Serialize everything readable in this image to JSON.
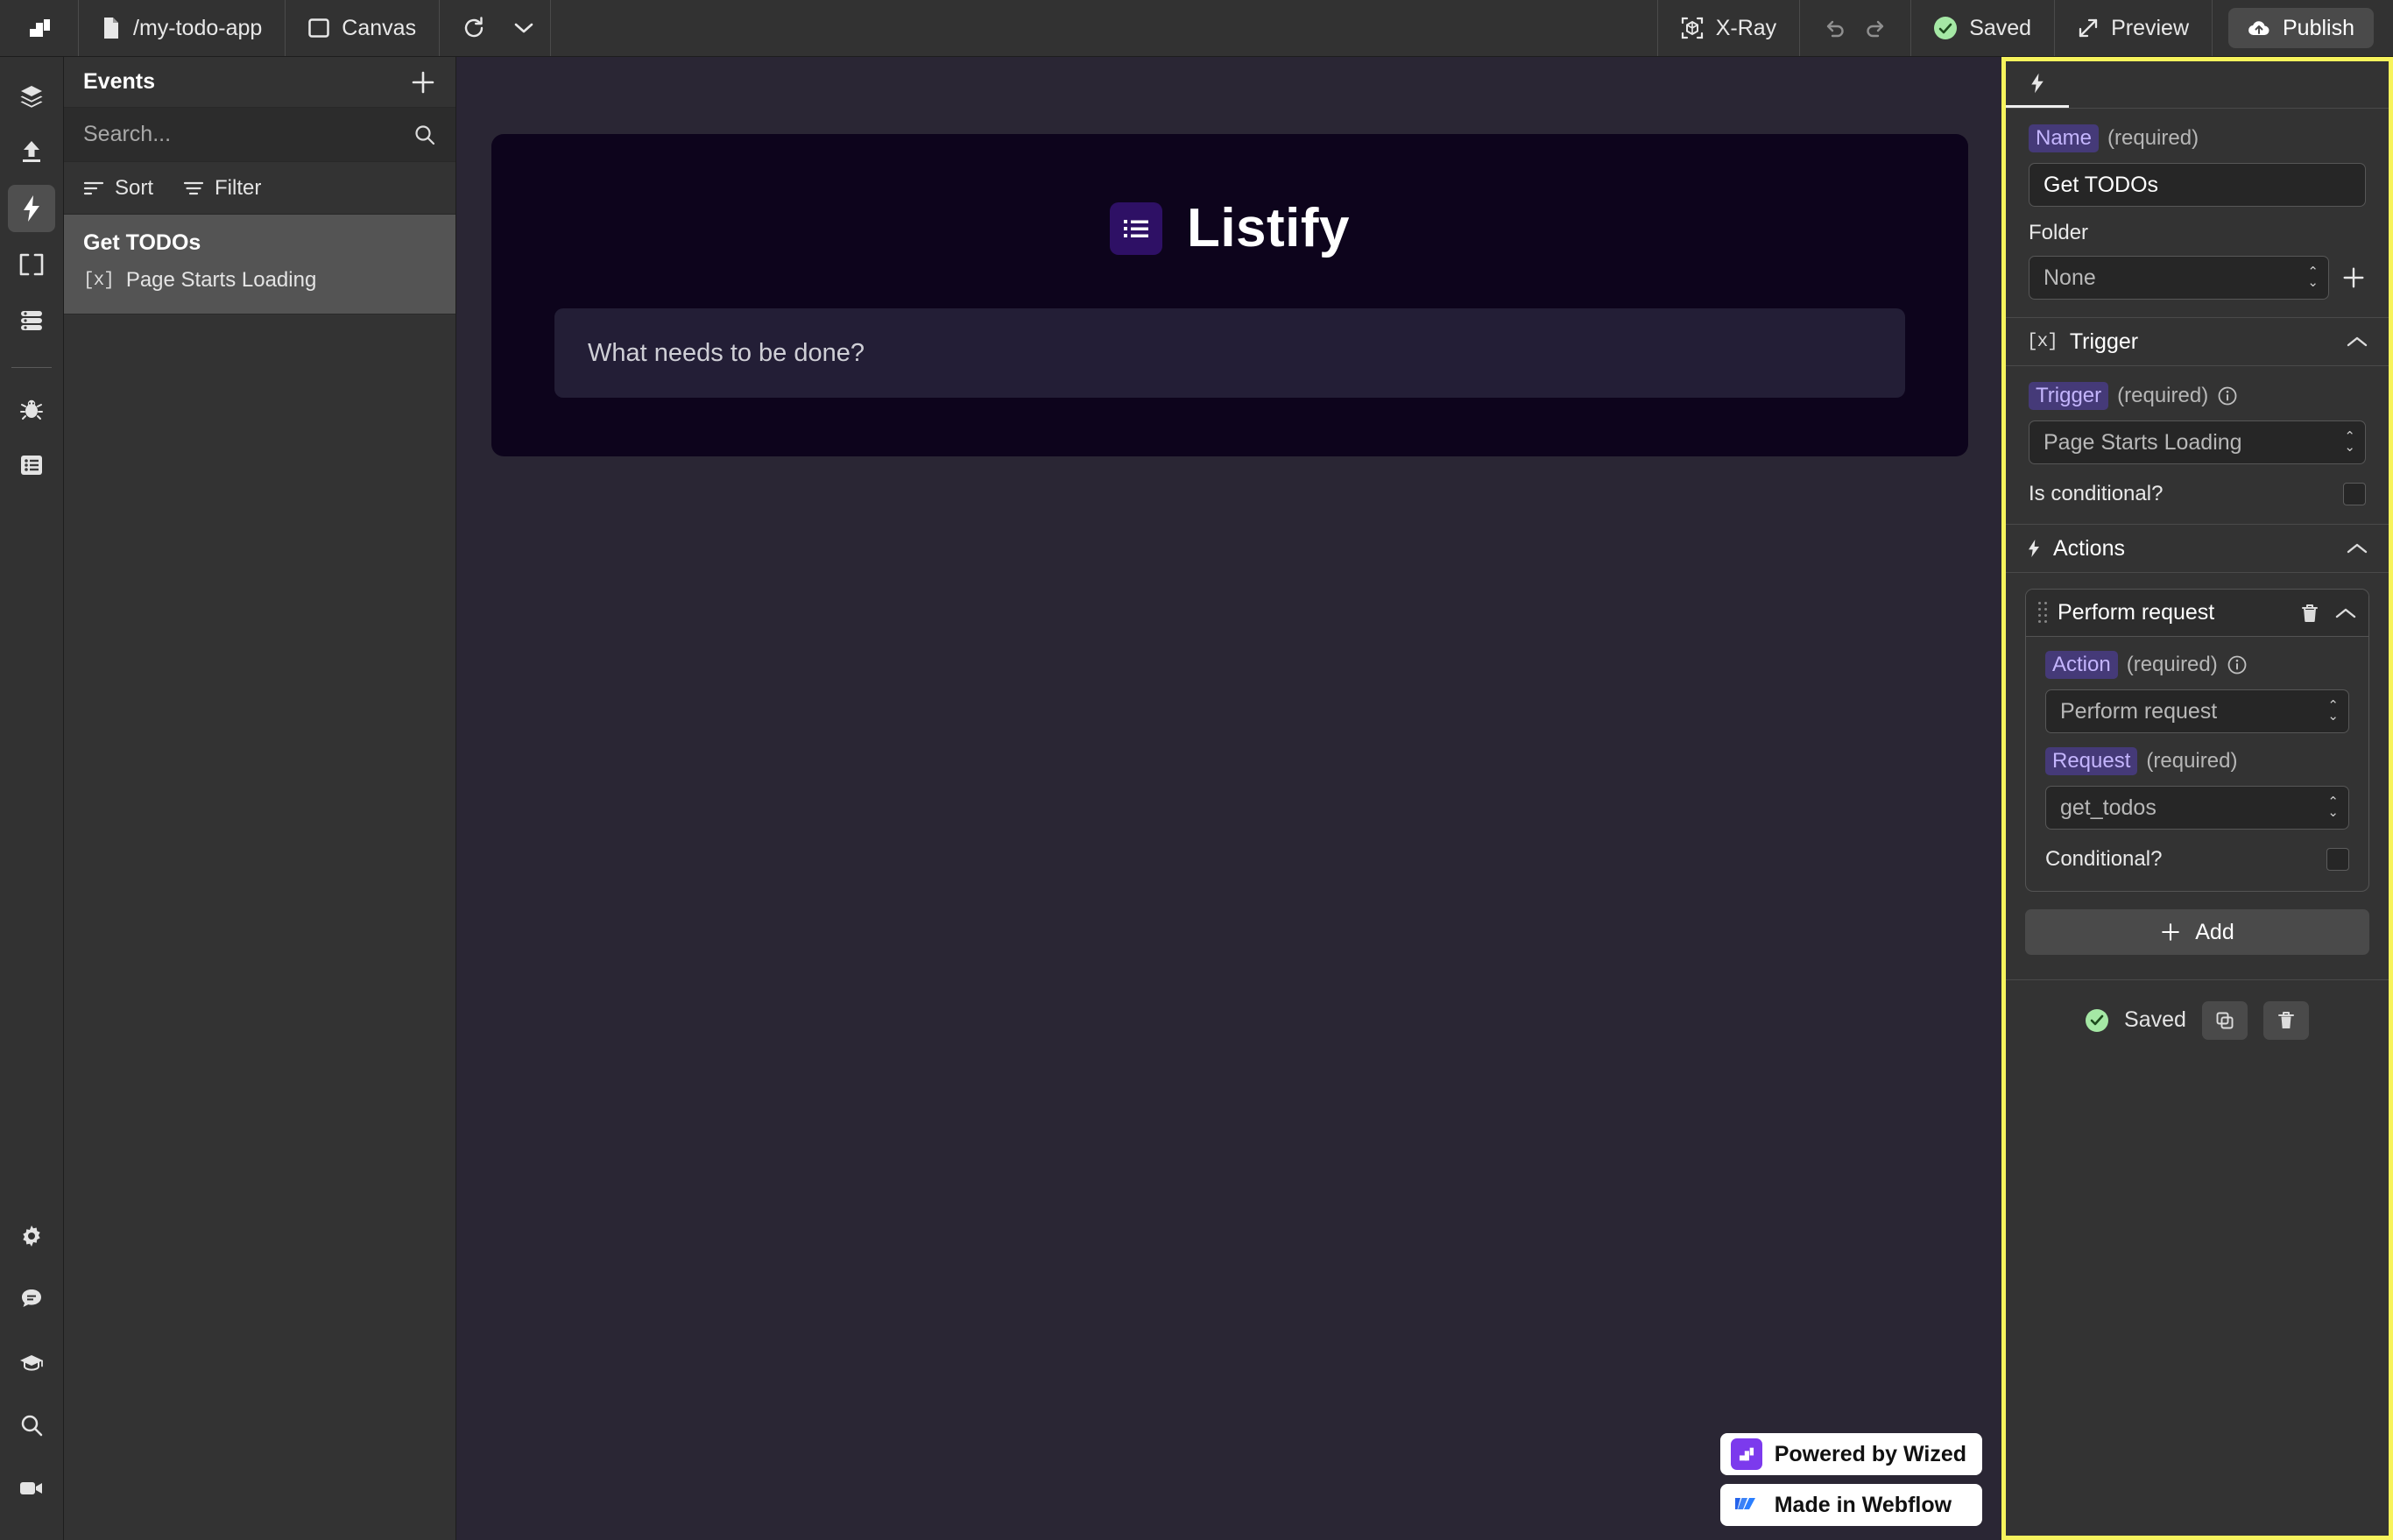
{
  "topbar": {
    "logo_icon": "wized-logo-icon",
    "page_path": "/my-todo-app",
    "page_icon": "file-icon",
    "canvas_label": "Canvas",
    "canvas_icon": "window-icon",
    "refresh_icon": "refresh-icon",
    "chevron_icon": "chevron-down-icon",
    "xray_label": "X-Ray",
    "xray_icon": "xray-cube-icon",
    "undo_icon": "undo-arrow-icon",
    "redo_icon": "redo-arrow-icon",
    "saved_label": "Saved",
    "saved_icon": "check-circle-icon",
    "preview_label": "Preview",
    "preview_icon": "expand-arrow-icon",
    "publish_label": "Publish",
    "publish_icon": "cloud-upload-icon"
  },
  "rail": {
    "items": [
      {
        "name": "layers",
        "icon": "layers-icon",
        "active": false
      },
      {
        "name": "upload",
        "icon": "upload-icon",
        "active": false
      },
      {
        "name": "events",
        "icon": "lightning-bolt-icon",
        "active": true
      },
      {
        "name": "variables",
        "icon": "brackets-icon",
        "active": false
      },
      {
        "name": "requests",
        "icon": "database-icon",
        "active": false
      }
    ],
    "bottom_items": [
      {
        "name": "debug",
        "icon": "bug-icon"
      },
      {
        "name": "logs",
        "icon": "list-panel-icon"
      },
      {
        "name": "settings",
        "icon": "gear-icon"
      },
      {
        "name": "chat",
        "icon": "chat-bubble-icon"
      },
      {
        "name": "academy",
        "icon": "graduation-cap-icon"
      },
      {
        "name": "search",
        "icon": "magnifier-icon"
      },
      {
        "name": "video",
        "icon": "video-camera-icon"
      }
    ]
  },
  "events_panel": {
    "title": "Events",
    "add_icon": "plus-icon",
    "search_placeholder": "Search...",
    "search_value": "",
    "search_icon": "magnifier-icon",
    "sort_label": "Sort",
    "sort_icon": "sort-icon",
    "filter_label": "Filter",
    "filter_icon": "filter-icon",
    "items": [
      {
        "title": "Get TODOs",
        "trigger": "Page Starts Loading",
        "trigger_icon": "brackets-x-icon",
        "selected": true
      }
    ]
  },
  "canvas": {
    "brand_name": "Listify",
    "brand_icon": "list-icon",
    "todo_placeholder": "What needs to be done?",
    "badges": [
      {
        "label": "Powered by Wized",
        "icon": "wized-logo-icon"
      },
      {
        "label": "Made in Webflow",
        "icon": "webflow-logo-icon"
      }
    ]
  },
  "inspector": {
    "tab_icon": "lightning-bolt-icon",
    "name_label": "Name",
    "name_required": "(required)",
    "name_value": "Get TODOs",
    "folder_label": "Folder",
    "folder_value": "None",
    "folder_add_icon": "plus-icon",
    "trigger_section": {
      "icon": "brackets-x-icon",
      "title": "Trigger",
      "caret_icon": "chevron-up-icon",
      "field_label": "Trigger",
      "field_required": "(required)",
      "info_icon": "info-icon",
      "field_value": "Page Starts Loading",
      "conditional_label": "Is conditional?",
      "conditional_checked": false
    },
    "actions_section": {
      "icon": "lightning-bolt-icon",
      "title": "Actions",
      "caret_icon": "chevron-up-icon",
      "cards": [
        {
          "title": "Perform request",
          "grip_icon": "drag-grip-icon",
          "delete_icon": "trash-icon",
          "caret_icon": "chevron-up-icon",
          "action_label": "Action",
          "action_required": "(required)",
          "action_info_icon": "info-icon",
          "action_value": "Perform request",
          "request_label": "Request",
          "request_required": "(required)",
          "request_value": "get_todos",
          "conditional_label": "Conditional?",
          "conditional_checked": false
        }
      ],
      "add_label": "Add",
      "add_icon": "plus-icon"
    },
    "footer": {
      "saved_label": "Saved",
      "saved_icon": "check-circle-icon",
      "duplicate_icon": "copy-icon",
      "delete_icon": "trash-icon"
    },
    "highlight_color": "#f7f35c"
  }
}
